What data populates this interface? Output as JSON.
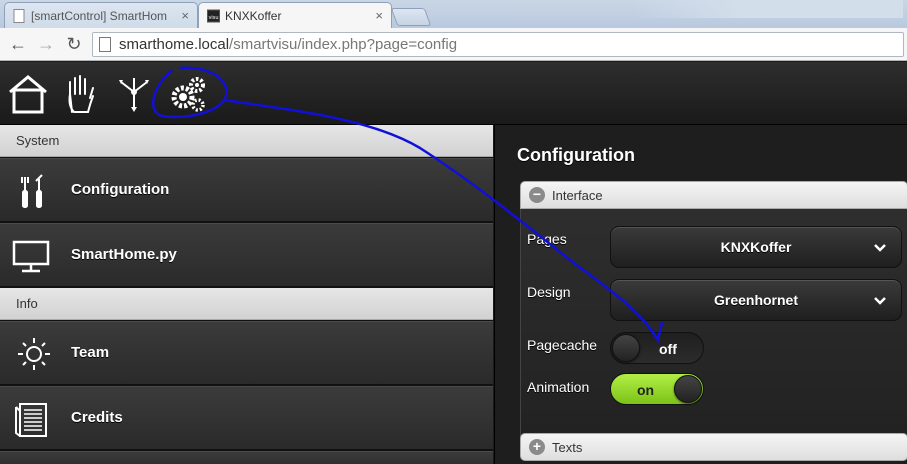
{
  "browser": {
    "tabs": [
      {
        "title": "[smartControl] SmartHom",
        "active": false
      },
      {
        "title": "KNXKoffer",
        "active": true
      }
    ],
    "url_host": "smarthome.local",
    "url_path": "/smartvisu/index.php?page=config"
  },
  "header": {
    "nav_icons": [
      "home-icon",
      "hand-icon",
      "network-icon",
      "gears-icon"
    ]
  },
  "menu": {
    "section_system": "System",
    "section_info": "Info",
    "items": [
      {
        "label": "Configuration",
        "icon": "tools-icon"
      },
      {
        "label": "SmartHome.py",
        "icon": "monitor-icon"
      },
      {
        "label": "Team",
        "icon": "sun-icon"
      },
      {
        "label": "Credits",
        "icon": "document-icon"
      }
    ]
  },
  "config": {
    "title": "Configuration",
    "interface_header": "Interface",
    "texts_header": "Texts",
    "pages_label": "Pages",
    "pages_value": "KNXKoffer",
    "design_label": "Design",
    "design_value": "Greenhornet",
    "pagecache_label": "Pagecache",
    "pagecache_value": "off",
    "animation_label": "Animation",
    "animation_value": "on"
  },
  "colors": {
    "accent_green": "#9ad82a",
    "annotation_blue": "#0000cc"
  }
}
